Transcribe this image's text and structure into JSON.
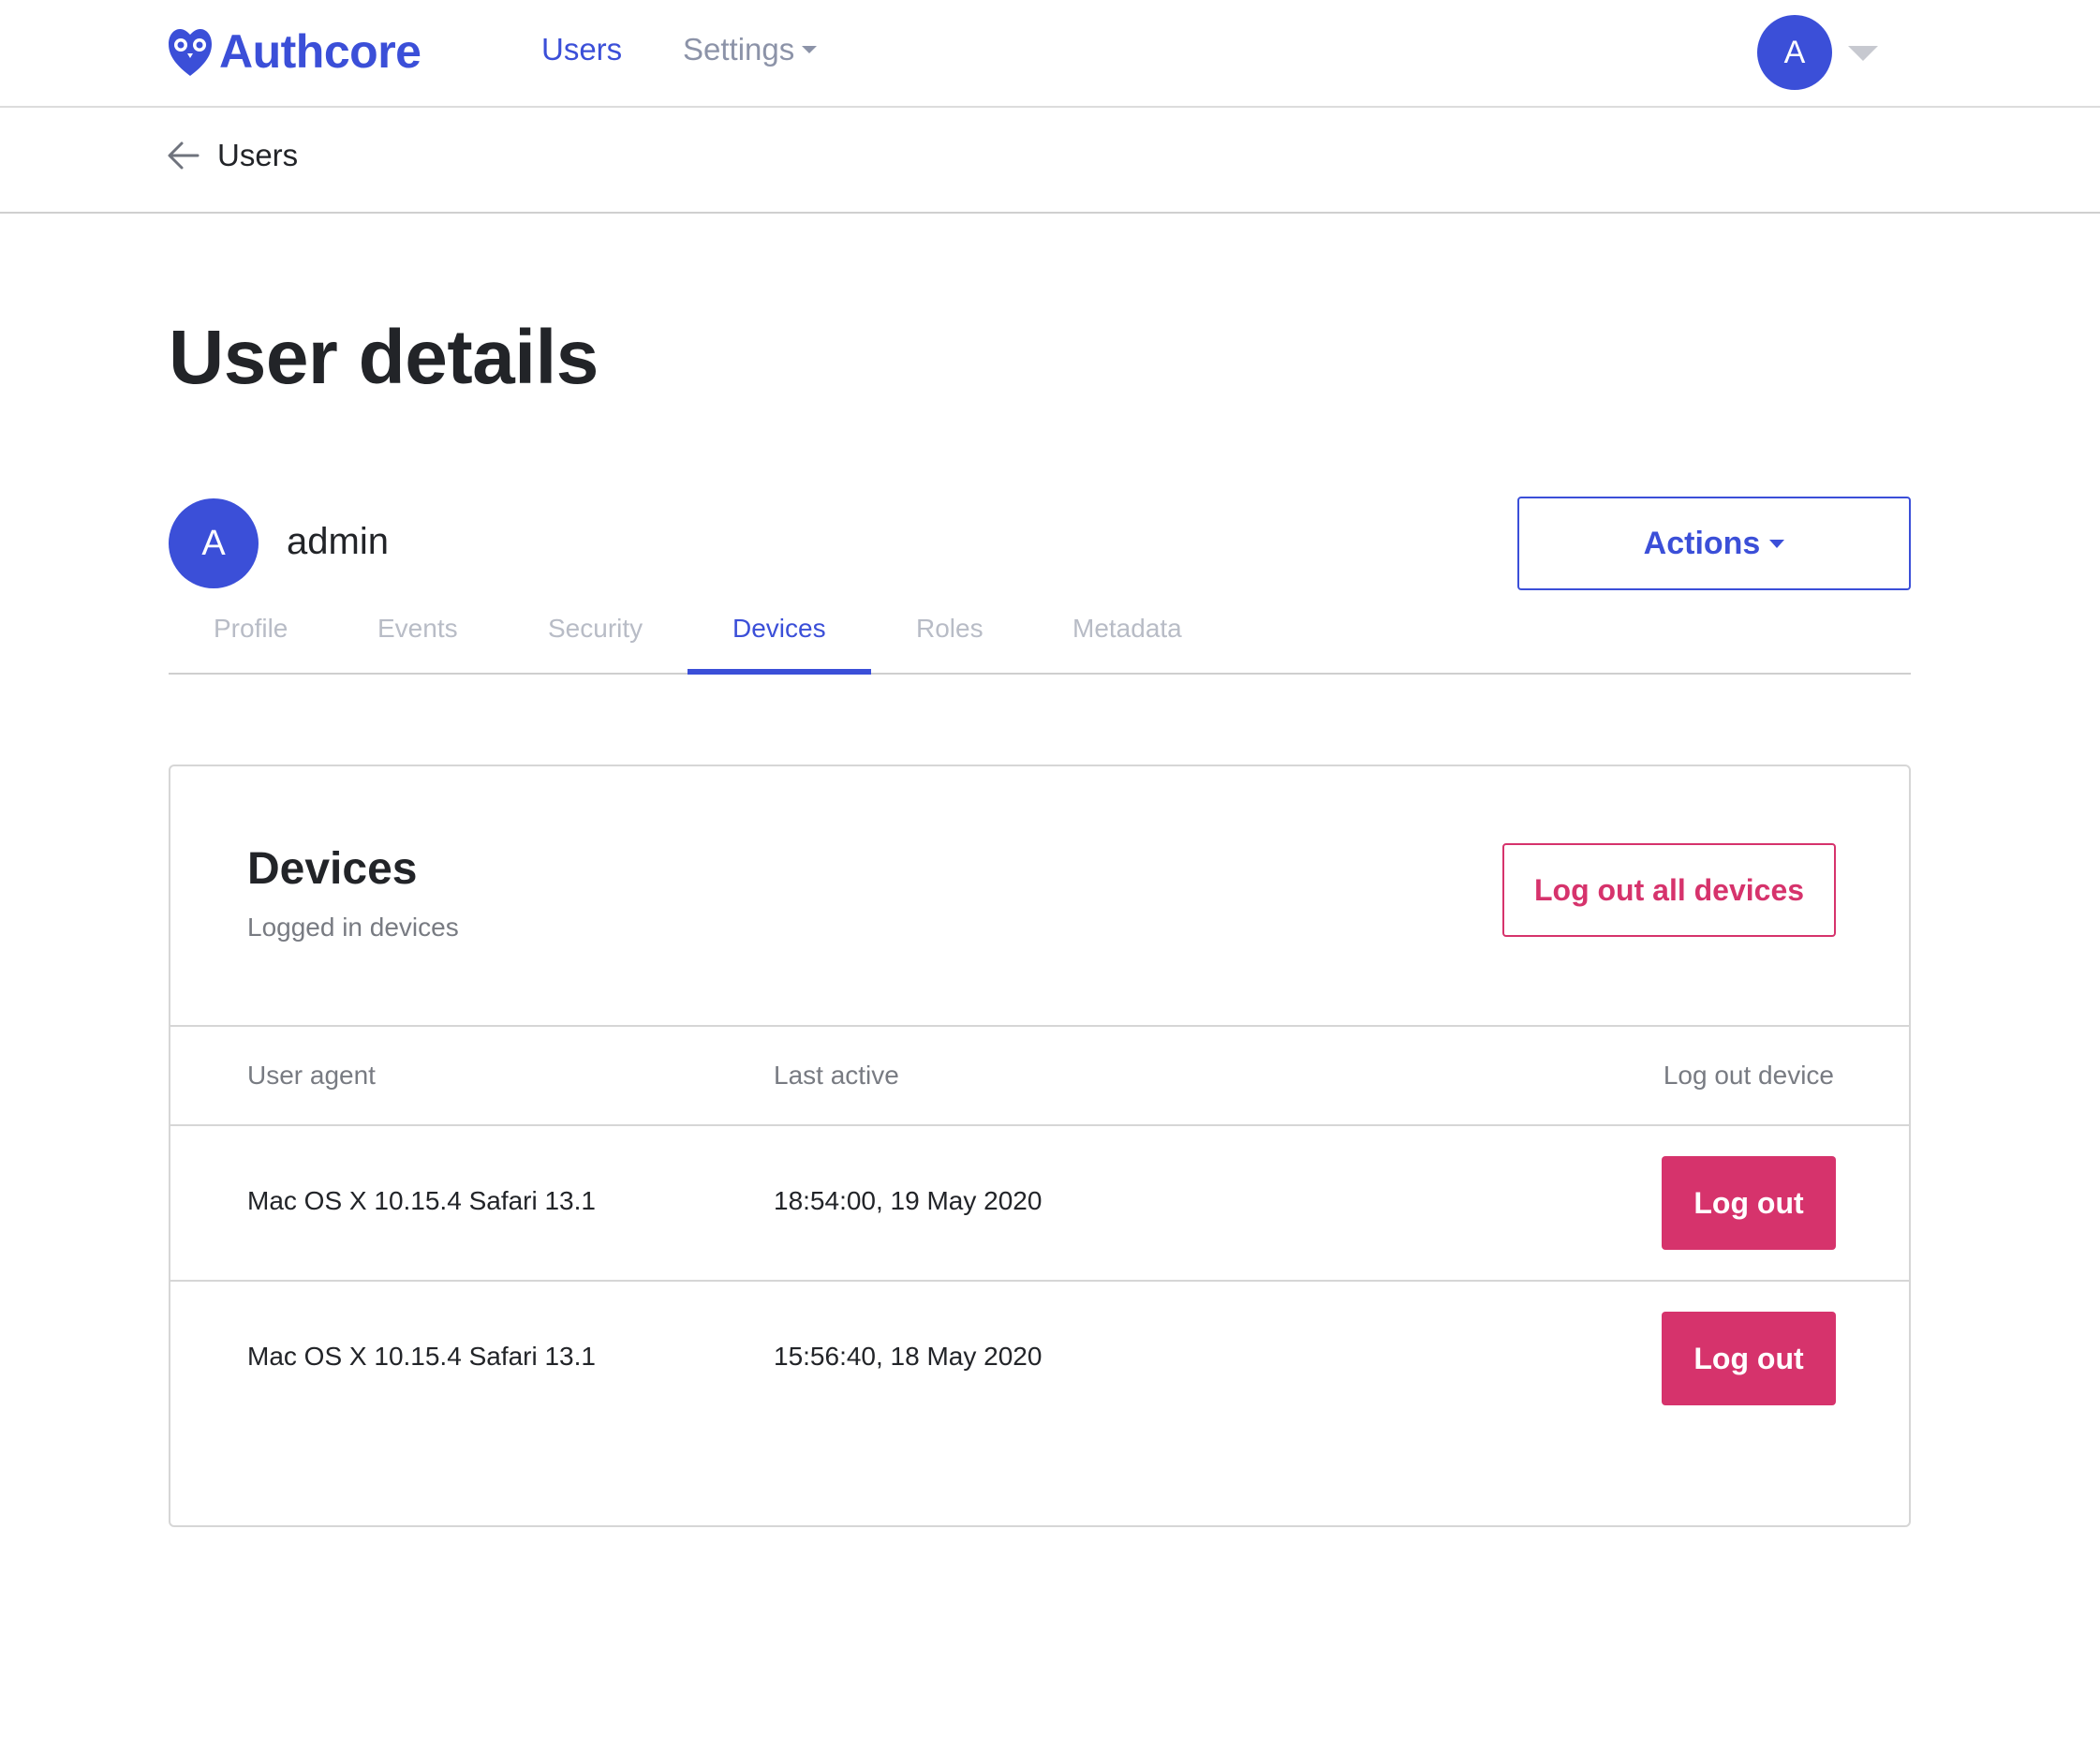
{
  "brand": {
    "name": "Authcore",
    "color": "#3b4fd8"
  },
  "nav": {
    "links": [
      {
        "label": "Users",
        "active": true
      },
      {
        "label": "Settings",
        "active": false,
        "has_dropdown": true
      }
    ],
    "avatar_initial": "A"
  },
  "breadcrumb": {
    "back_icon": "arrow-left-icon",
    "label": "Users"
  },
  "page": {
    "title": "User details"
  },
  "user": {
    "initial": "A",
    "name": "admin"
  },
  "actions": {
    "label": "Actions"
  },
  "tabs": [
    {
      "label": "Profile",
      "active": false
    },
    {
      "label": "Events",
      "active": false
    },
    {
      "label": "Security",
      "active": false
    },
    {
      "label": "Devices",
      "active": true
    },
    {
      "label": "Roles",
      "active": false
    },
    {
      "label": "Metadata",
      "active": false
    }
  ],
  "devices": {
    "title": "Devices",
    "subtitle": "Logged in devices",
    "logout_all_label": "Log out all devices",
    "columns": [
      "User agent",
      "Last active",
      "Log out device"
    ],
    "rows": [
      {
        "user_agent": "Mac OS X 10.15.4 Safari 13.1",
        "last_active": "18:54:00, 19 May 2020",
        "action_label": "Log out"
      },
      {
        "user_agent": "Mac OS X 10.15.4 Safari 13.1",
        "last_active": "15:56:40, 18 May 2020",
        "action_label": "Log out"
      }
    ]
  },
  "colors": {
    "accent": "#3b4fd8",
    "danger": "#d6336c",
    "muted_text": "#787b82"
  }
}
